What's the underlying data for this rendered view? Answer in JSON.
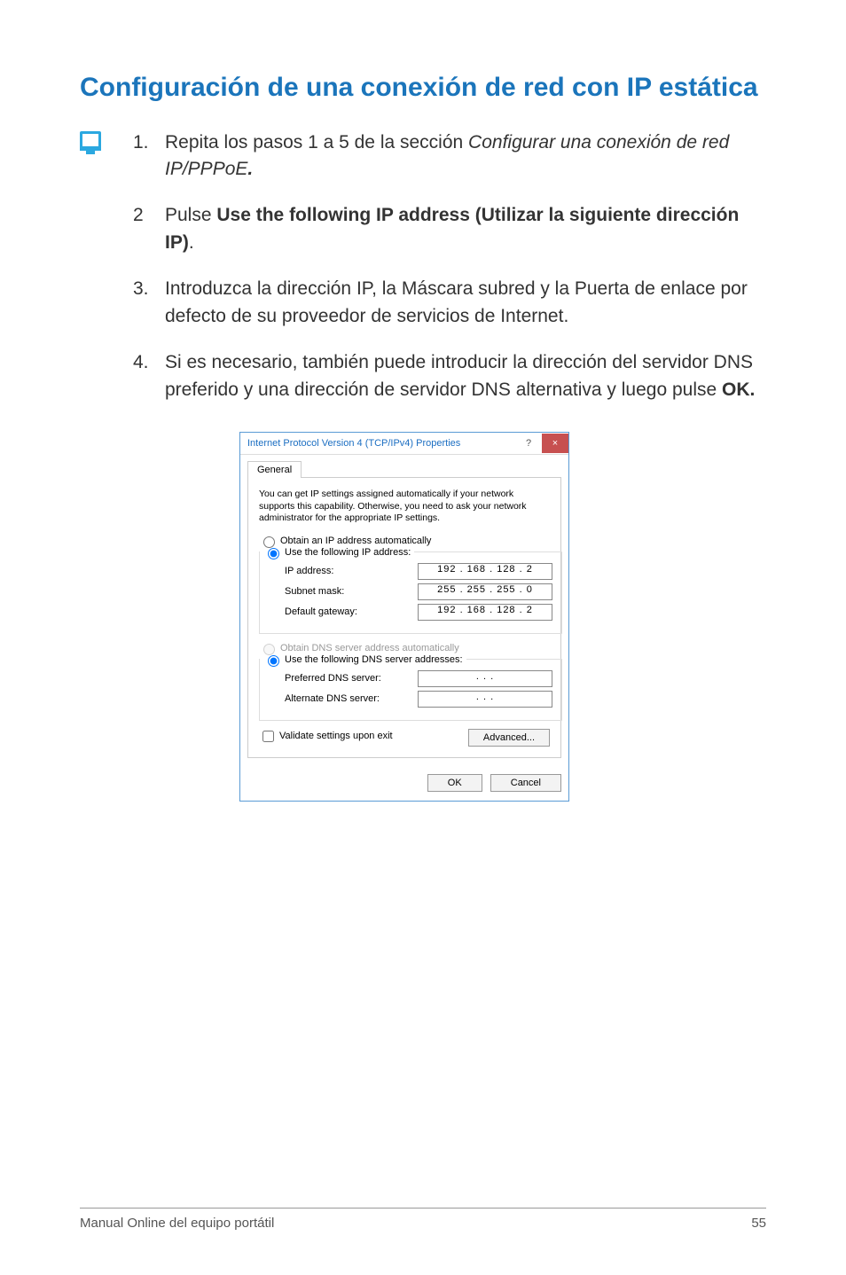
{
  "title": "Configuración de una conexión de red con IP estática",
  "steps": [
    {
      "num": "1.",
      "prefix": "Repita los pasos 1 a 5 de la sección ",
      "italic": "Configurar una conexión de red IP/PPPoE",
      "bold_suffix": "."
    },
    {
      "num": "2",
      "prefix": "Pulse ",
      "bold": "Use the following IP address (Utilizar la siguiente dirección IP)",
      "suffix": "."
    },
    {
      "num": "3.",
      "text": "Introduzca la dirección IP, la Máscara subred y la Puerta de enlace por defecto de su proveedor de servicios de Internet."
    },
    {
      "num": "4.",
      "prefix": "Si es necesario, también puede introducir la dirección del servidor DNS preferido y una dirección de servidor DNS alternativa y luego pulse ",
      "bold": "OK."
    }
  ],
  "dialog": {
    "title": "Internet Protocol Version 4 (TCP/IPv4) Properties",
    "help": "?",
    "close": "×",
    "tab": "General",
    "description": "You can get IP settings assigned automatically if your network supports this capability. Otherwise, you need to ask your network administrator for the appropriate IP settings.",
    "radio_obtain_ip": "Obtain an IP address automatically",
    "radio_use_ip": "Use the following IP address:",
    "lbl_ip": "IP address:",
    "val_ip": "192 . 168 . 128 .  2",
    "lbl_subnet": "Subnet mask:",
    "val_subnet": "255 . 255 . 255 .  0",
    "lbl_gateway": "Default gateway:",
    "val_gateway": "192 . 168 . 128 .  2",
    "radio_obtain_dns": "Obtain DNS server address automatically",
    "radio_use_dns": "Use the following DNS server addresses:",
    "lbl_pref_dns": "Preferred DNS server:",
    "val_pref_dns": ".       .       .",
    "lbl_alt_dns": "Alternate DNS server:",
    "val_alt_dns": ".       .       .",
    "chk_validate": "Validate settings upon exit",
    "btn_advanced": "Advanced...",
    "btn_ok": "OK",
    "btn_cancel": "Cancel"
  },
  "footer": {
    "left": "Manual Online del equipo portátil",
    "right": "55"
  }
}
